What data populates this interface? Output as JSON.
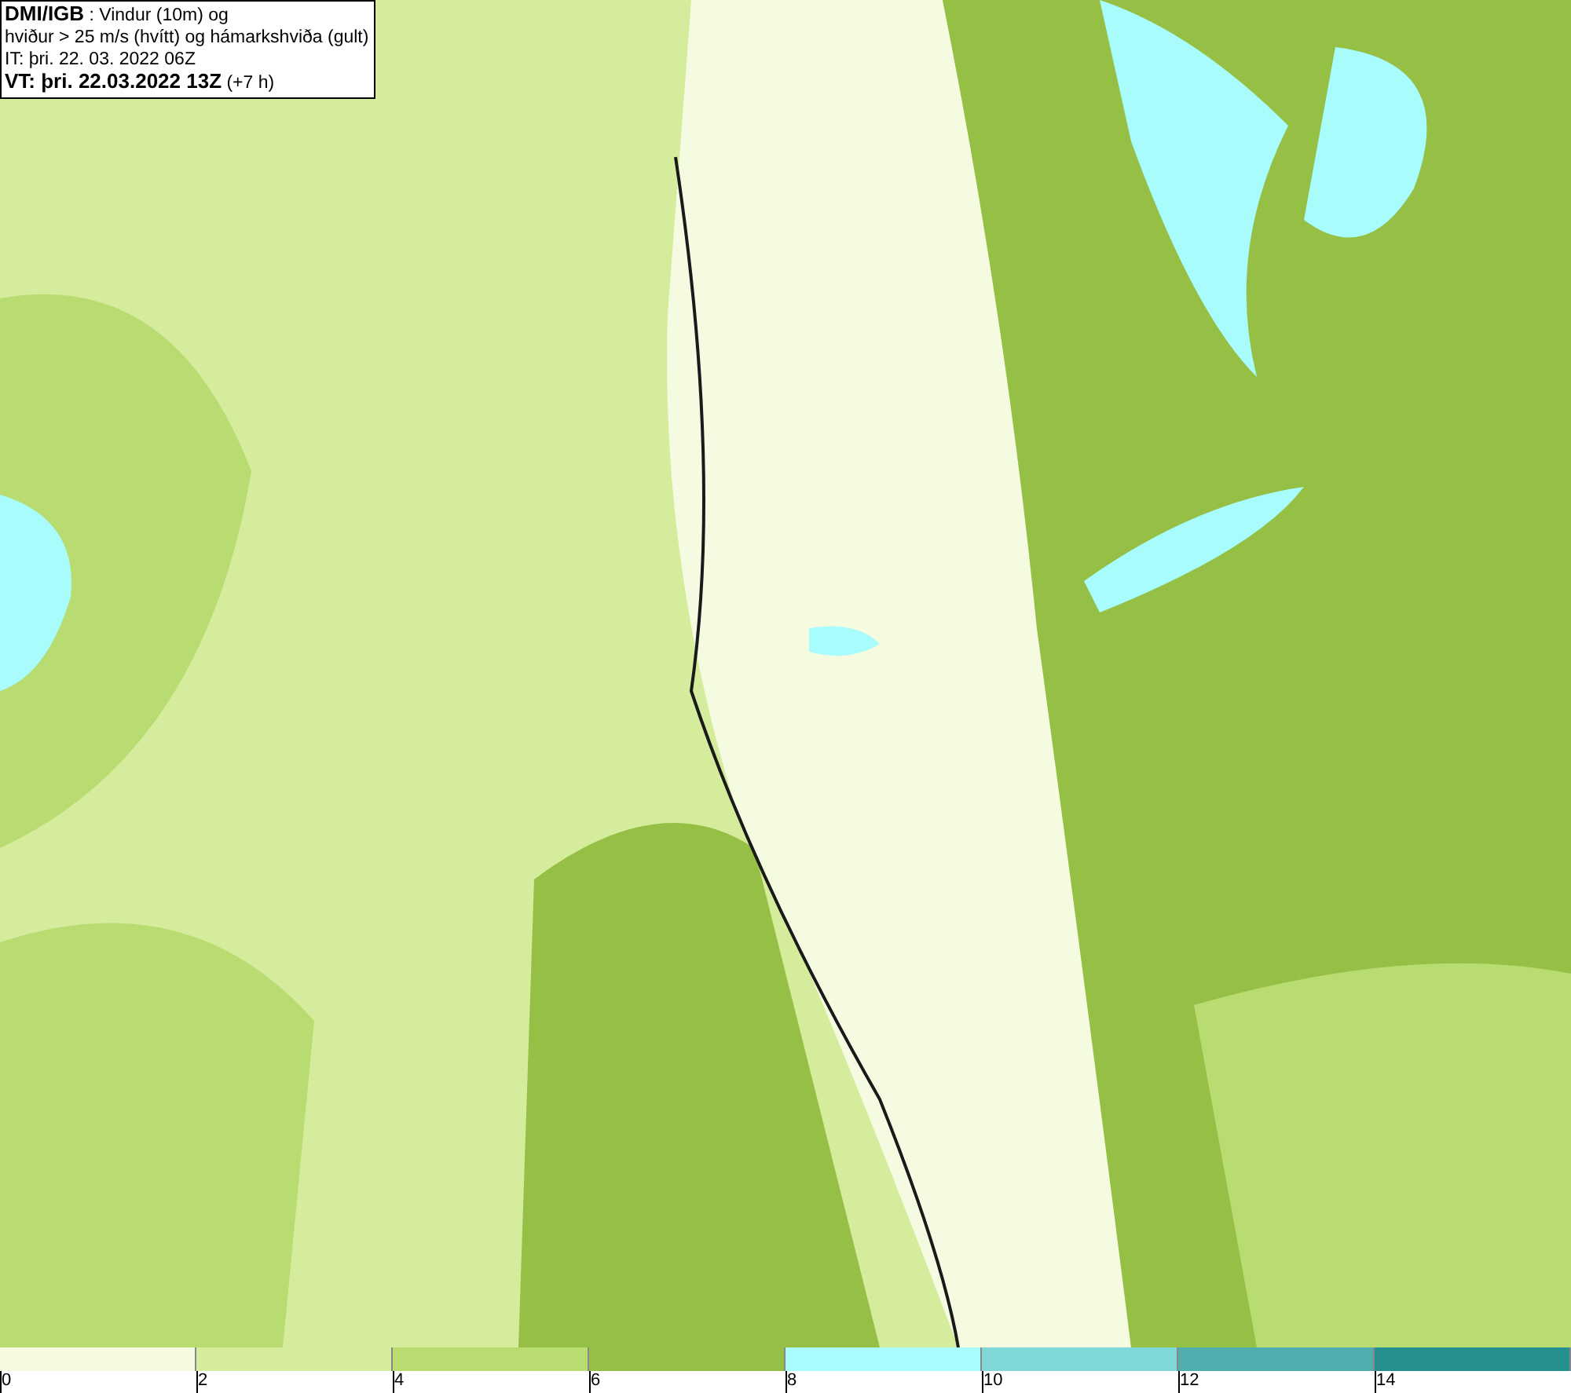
{
  "info_box": {
    "lines": [
      "**DMI/IGB** : Vindur (10m) og",
      "hviður > 25 m/s (hvítt) og hámarkshviða (gult)",
      "IT: þri. 22. 03. 2022 06Z",
      "**VT: þri. 22.03.2022 13Z** (+7 h)"
    ]
  },
  "legend": {
    "bins": [
      {
        "color": "#f4fbe0"
      },
      {
        "color": "#d4ec9c"
      },
      {
        "color": "#b8dc72"
      },
      {
        "color": "#95bf45"
      },
      {
        "color": "#a8fcfc"
      },
      {
        "color": "#80d7d7"
      },
      {
        "color": "#50adad"
      },
      {
        "color": "#268f8f"
      }
    ],
    "ticks": [
      "0",
      "2",
      "4",
      "6",
      "8",
      "10",
      "12",
      "14"
    ]
  }
}
